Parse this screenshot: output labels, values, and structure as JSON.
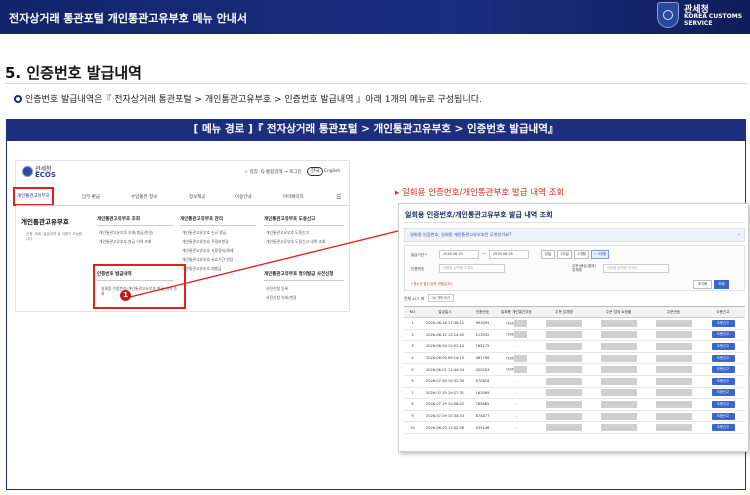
{
  "doc_title": "전자상거래 통관포털 개인통관고유부호 메뉴 안내서",
  "org": {
    "name": "관세청",
    "sub1": "KOREA CUSTOMS",
    "sub2": "SERVICE"
  },
  "section_title": "5. 인증번호 발급내역",
  "intro_text": "인증번호 발급내역은『 전자상거래 통관포털 > 개인통관고유부호 > 인증번호 발급내역 』아래 1개의 메뉴로 구성됩니다.",
  "menu_path": "[ 메뉴 경로 ]『 전자상거래 통관포털 >  개인통관고유부호 >  인증번호 발급내역』",
  "site": {
    "logo_top": "관세청",
    "logo_name": "ECOS",
    "toolbar": [
      "☆ 방침",
      "Q 통합검색",
      "→ 로그인"
    ],
    "lang_ko": "한국",
    "lang_en": "English",
    "gnb": [
      "개인통관고유부호",
      "납부·환급",
      "수입통관 정보",
      "정보제공",
      "이용안내",
      "마이페이지"
    ],
    "left_title": "개인통관고유부호",
    "left_desc": "신청, 조회, 발급내역 등 이용이 가능합니다.",
    "groups": [
      {
        "title": "개인통관고유부호 조회",
        "items": [
          "개인통관고유부호 조회(발급/변경)",
          "개인통관고유부호 발급 이력 조회"
        ]
      },
      {
        "title": "개인통관고유부호 관리",
        "items": [
          "개인통관고유부호 신규 발급",
          "개인통관고유부호 주정보변경",
          "개인통관고유부호 사용정지/해제",
          "개인통관고유부호 유효기간 연장",
          "개인통관고유부호 재발급"
        ]
      },
      {
        "title": "개인통관고유부호 도용신고",
        "items": [
          "개인통관고유부호 도용신고",
          "개인통관고유부호 도용신고 내역 조회"
        ]
      },
      {
        "title": "인증번호 발급내역",
        "items": [
          "일회용 인증번호/개인통관고유부호 발급 내역 조회"
        ]
      },
      {
        "title": "개인통관고유부호 명의발급 사전신청",
        "items": [
          "사전신청 등록",
          "사전신청 조회/변경"
        ]
      }
    ],
    "badge": "1"
  },
  "right_label": "▸ 일회용 인증번호/개인통관부호 발급 내역 조회",
  "shot": {
    "title": "일회용 인증번호/개인통관고유부호 발급 내역 조회",
    "faq": "일회용 인증번호, 일회용 개인통관고유부호란 무엇인가요?",
    "period_label": "발급기간 *",
    "date_from": "2026-06-19",
    "date_to": "2026-06-18",
    "periods": [
      "당일",
      "1주일",
      "1개월",
      "✓ 3개월"
    ],
    "cert_label": "인증번호",
    "cert_ph": "내용을 입력해 주세요",
    "code_label": "개인통관고유부호",
    "code_ph": "내용을 입력해 주세요",
    "usage_label": "주문(배송/결제) 업체명",
    "usage_ph": "내용을 입력해 주세요",
    "note": "* 표시는 필수 입력 사항입니다.",
    "reset": "초기화",
    "search": "조회",
    "total": "전체 417 개",
    "page_size": "10 개씩 보기",
    "columns": [
      "NO",
      "발급일시",
      "인증번호",
      "일회용 개인통관부호",
      "주문 업체명",
      "주문 업체 쇼핑몰",
      "주문번호",
      "도용신고"
    ],
    "rows": [
      {
        "no": "1",
        "date": "2026-06-18 17:38:12",
        "cert": "993494",
        "code": "O26"
      },
      {
        "no": "2",
        "date": "2026-06-12 13:14:45",
        "cert": "113932",
        "code": "O26"
      },
      {
        "no": "3",
        "date": "2026-06-04 10:02:14",
        "cert": "165175",
        "code": "-"
      },
      {
        "no": "4",
        "date": "2026-06-04 09:14:15",
        "cert": "087796",
        "code": "O26"
      },
      {
        "no": "5",
        "date": "2026-06-01 12:44:04",
        "cert": "420203",
        "code": "O26"
      },
      {
        "no": "6",
        "date": "2026-07-30 19:32:39",
        "cert": "570816",
        "code": "-"
      },
      {
        "no": "7",
        "date": "2026-07-30 19:27:31",
        "cert": "162069",
        "code": "-"
      },
      {
        "no": "8",
        "date": "2026-07-29 10:08:02",
        "cert": "785865",
        "code": "-"
      },
      {
        "no": "9",
        "date": "2026-07-09 15:34:53",
        "cert": "874877",
        "code": "-"
      },
      {
        "no": "10",
        "date": "2026-06-05 12:02:56",
        "cert": "039146",
        "code": "-"
      }
    ],
    "report_btn": "도용신고"
  },
  "colors": {
    "navy": "#1e2e7e",
    "red": "#e0201b",
    "blue_btn": "#3a67c9"
  }
}
